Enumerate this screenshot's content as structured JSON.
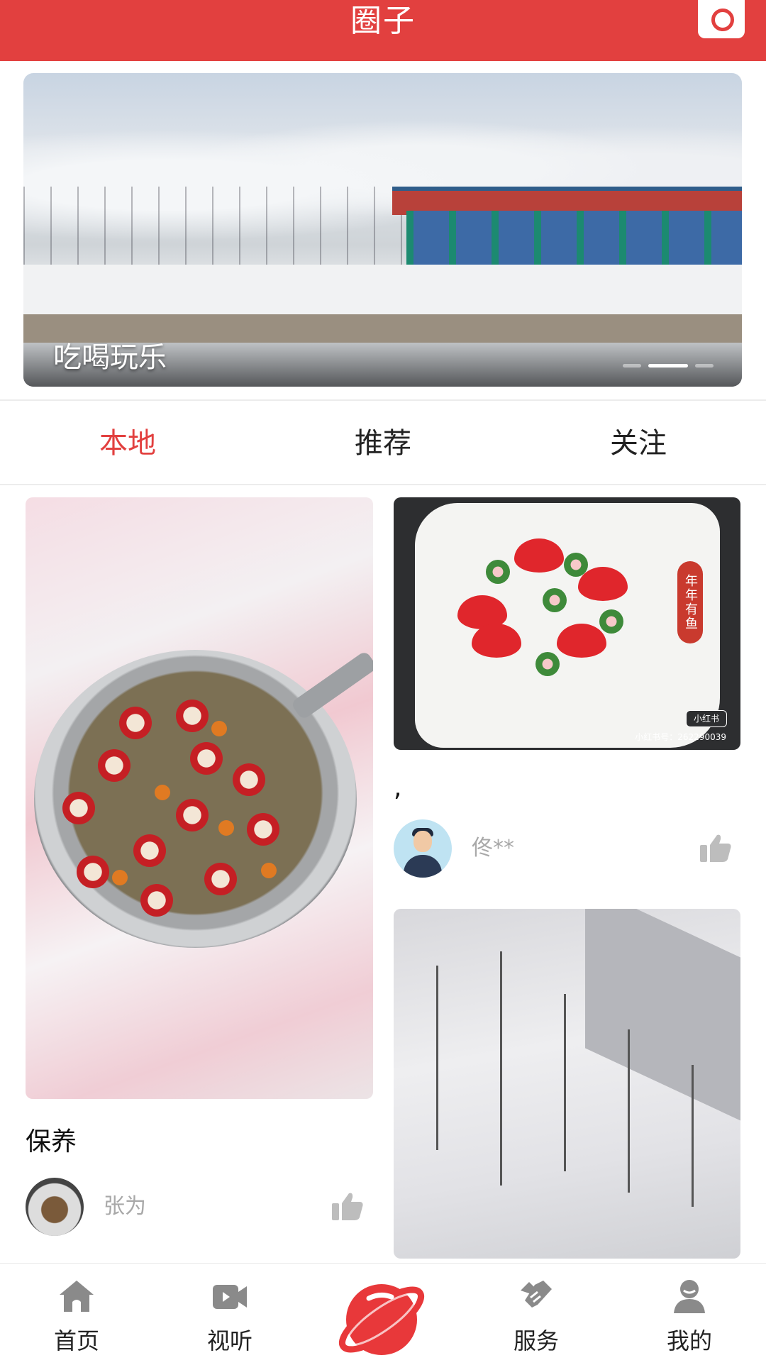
{
  "header": {
    "title": "圈子",
    "camera_icon": "camera-icon",
    "accent": "#e2403f"
  },
  "banner": {
    "caption": "吃喝玩乐",
    "active_dot": 1,
    "dot_count": 3
  },
  "tabs": [
    {
      "label": "本地",
      "active": true
    },
    {
      "label": "推荐",
      "active": false
    },
    {
      "label": "关注",
      "active": false
    }
  ],
  "feed": {
    "left": [
      {
        "title": "保养",
        "author": "张为",
        "like_icon": "thumbs-up-icon"
      }
    ],
    "right": [
      {
        "title": ",",
        "author": "佟**",
        "like_icon": "thumbs-up-icon",
        "image_seal": "年年有鱼",
        "image_badge": "小红书",
        "image_watermark": "小红书号：262290039"
      },
      {
        "title": ""
      }
    ]
  },
  "bottom_nav": [
    {
      "label": "首页",
      "icon": "home-icon"
    },
    {
      "label": "视听",
      "icon": "video-camera-icon"
    },
    {
      "label": "",
      "icon": "planet-icon"
    },
    {
      "label": "服务",
      "icon": "handshake-icon"
    },
    {
      "label": "我的",
      "icon": "user-icon"
    }
  ]
}
